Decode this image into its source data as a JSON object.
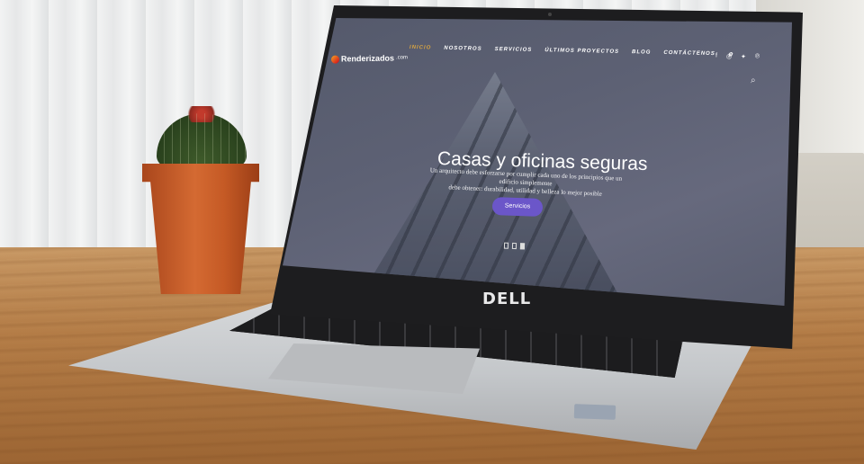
{
  "site": {
    "logo_text": "Renderizados",
    "logo_suffix": ".com",
    "nav": [
      "INICIO",
      "NOSOTROS",
      "SERVICIOS",
      "ÚLTIMOS PROYECTOS",
      "BLOG",
      "CONTÁCTENOS"
    ],
    "active_nav": "INICIO",
    "extra_nav_icon": "gear-icon",
    "social_icons": [
      "facebook-icon",
      "instagram-icon",
      "twitter-icon",
      "pinterest-icon"
    ],
    "search_icon": "search-icon",
    "hero": {
      "title": "Casas y oficinas seguras",
      "subtitle_1": "Un arquitecto debe esforzarse por cumplir cada uno de los principios que un edificio simplemente",
      "subtitle_2": "debe obtener: durabilidad, utilidad y belleza lo mejor posible",
      "button": "Servicios"
    }
  },
  "laptop": {
    "brand": "DELL"
  },
  "colors": {
    "accent": "#6b56c9",
    "active_nav": "#d9a441",
    "pot": "#c55a25",
    "table": "#b57e48"
  }
}
